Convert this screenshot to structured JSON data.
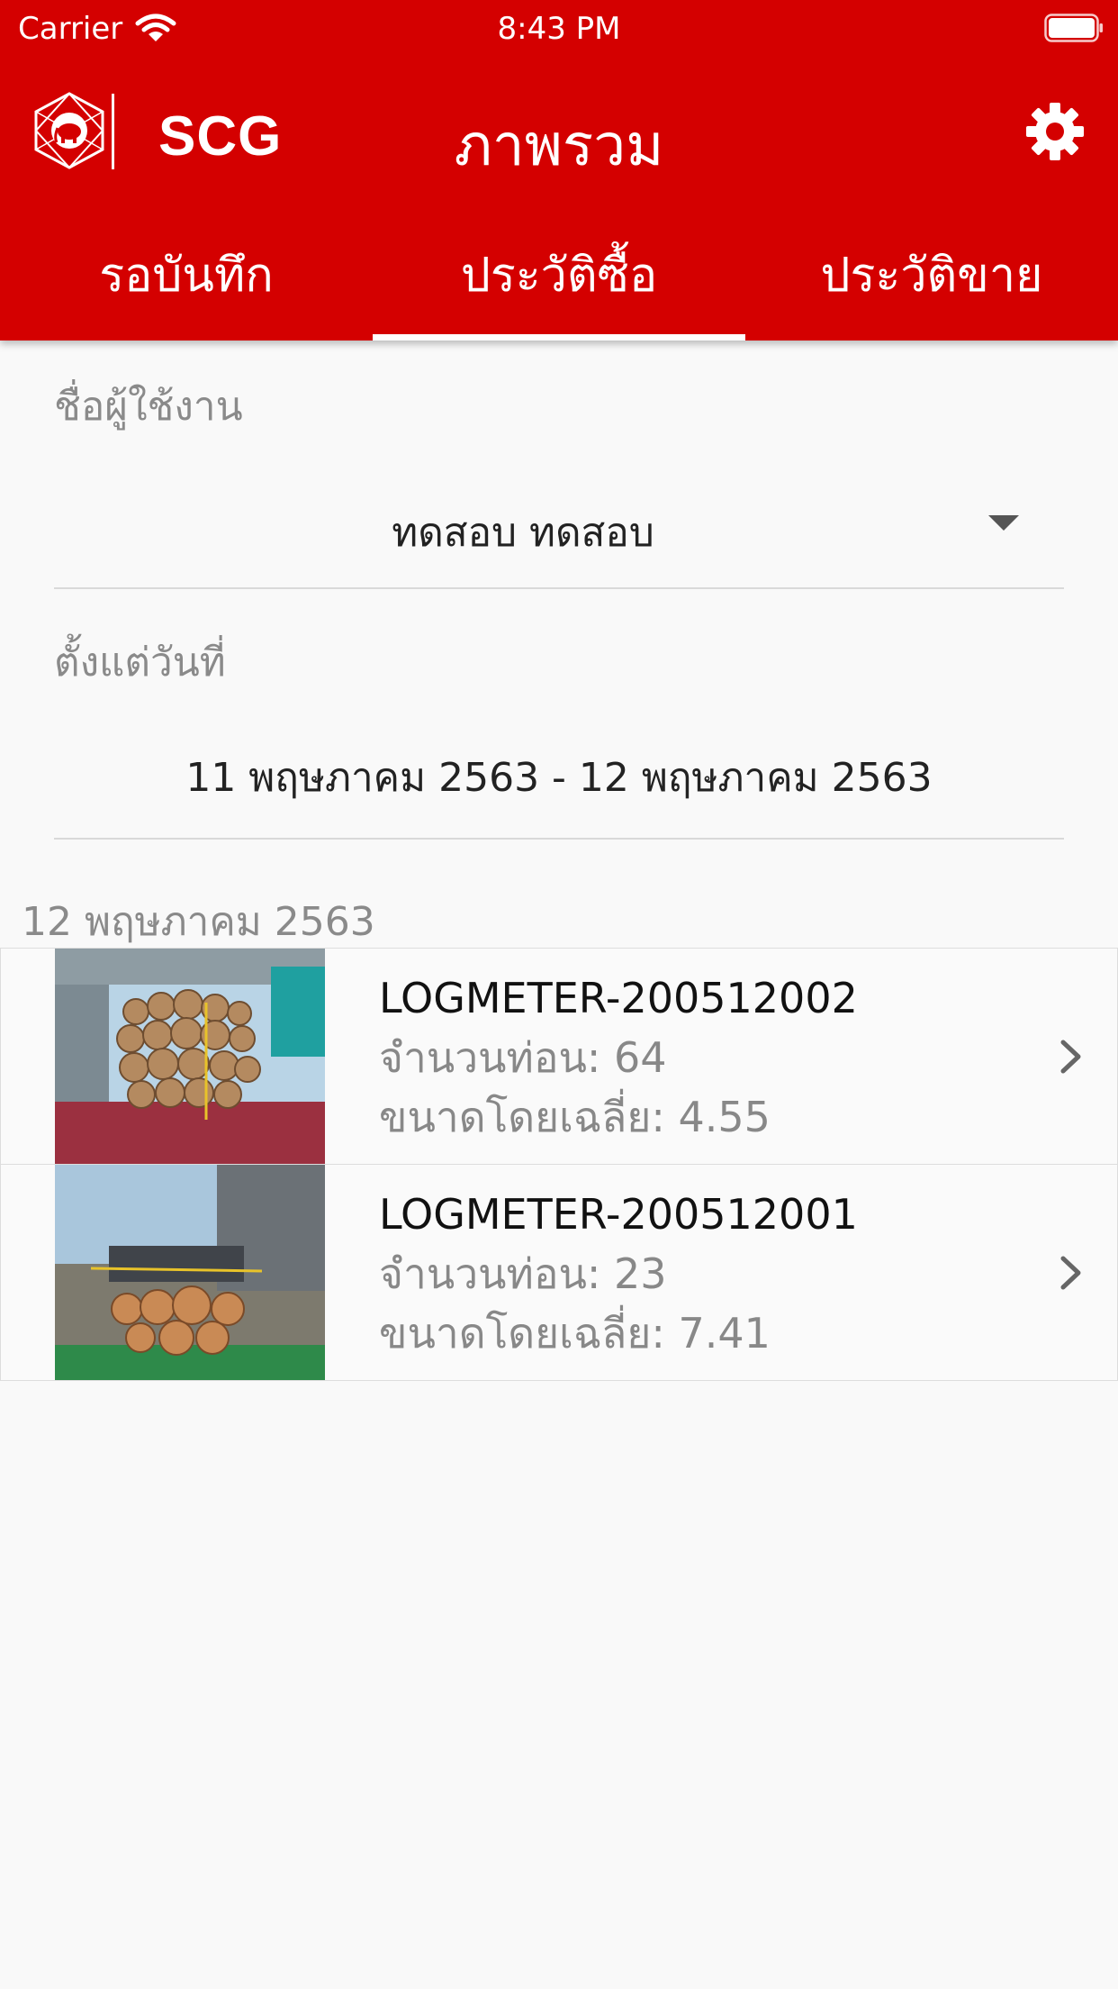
{
  "status_bar": {
    "carrier": "Carrier",
    "time": "8:43 PM"
  },
  "header": {
    "logo_text": "SCG",
    "title": "ภาพรวม",
    "settings_icon": "gear-icon"
  },
  "tabs": [
    {
      "label": "รอบันทึก",
      "active": false
    },
    {
      "label": "ประวัติซื้อ",
      "active": true
    },
    {
      "label": "ประวัติขาย",
      "active": false
    }
  ],
  "form": {
    "user_label": "ชื่อผู้ใช้งาน",
    "user_value": "ทดสอบ ทดสอบ",
    "date_label": "ตั้งแต่วันที่",
    "date_value": "11 พฤษภาคม 2563 - 12 พฤษภาคม 2563"
  },
  "section": {
    "date": "12 พฤษภาคม 2563"
  },
  "records": [
    {
      "title": "LOGMETER-200512002",
      "count_label": "จำนวนท่อน:",
      "count": "64",
      "size_label": "ขนาดโดยเฉลี่ย:",
      "size": "4.55"
    },
    {
      "title": "LOGMETER-200512001",
      "count_label": "จำนวนท่อน:",
      "count": "23",
      "size_label": "ขนาดโดยเฉลี่ย:",
      "size": "7.41"
    }
  ],
  "colors": {
    "brand_red": "#d40000",
    "background": "#f9f9f9",
    "muted_text": "#8a8a8a"
  }
}
